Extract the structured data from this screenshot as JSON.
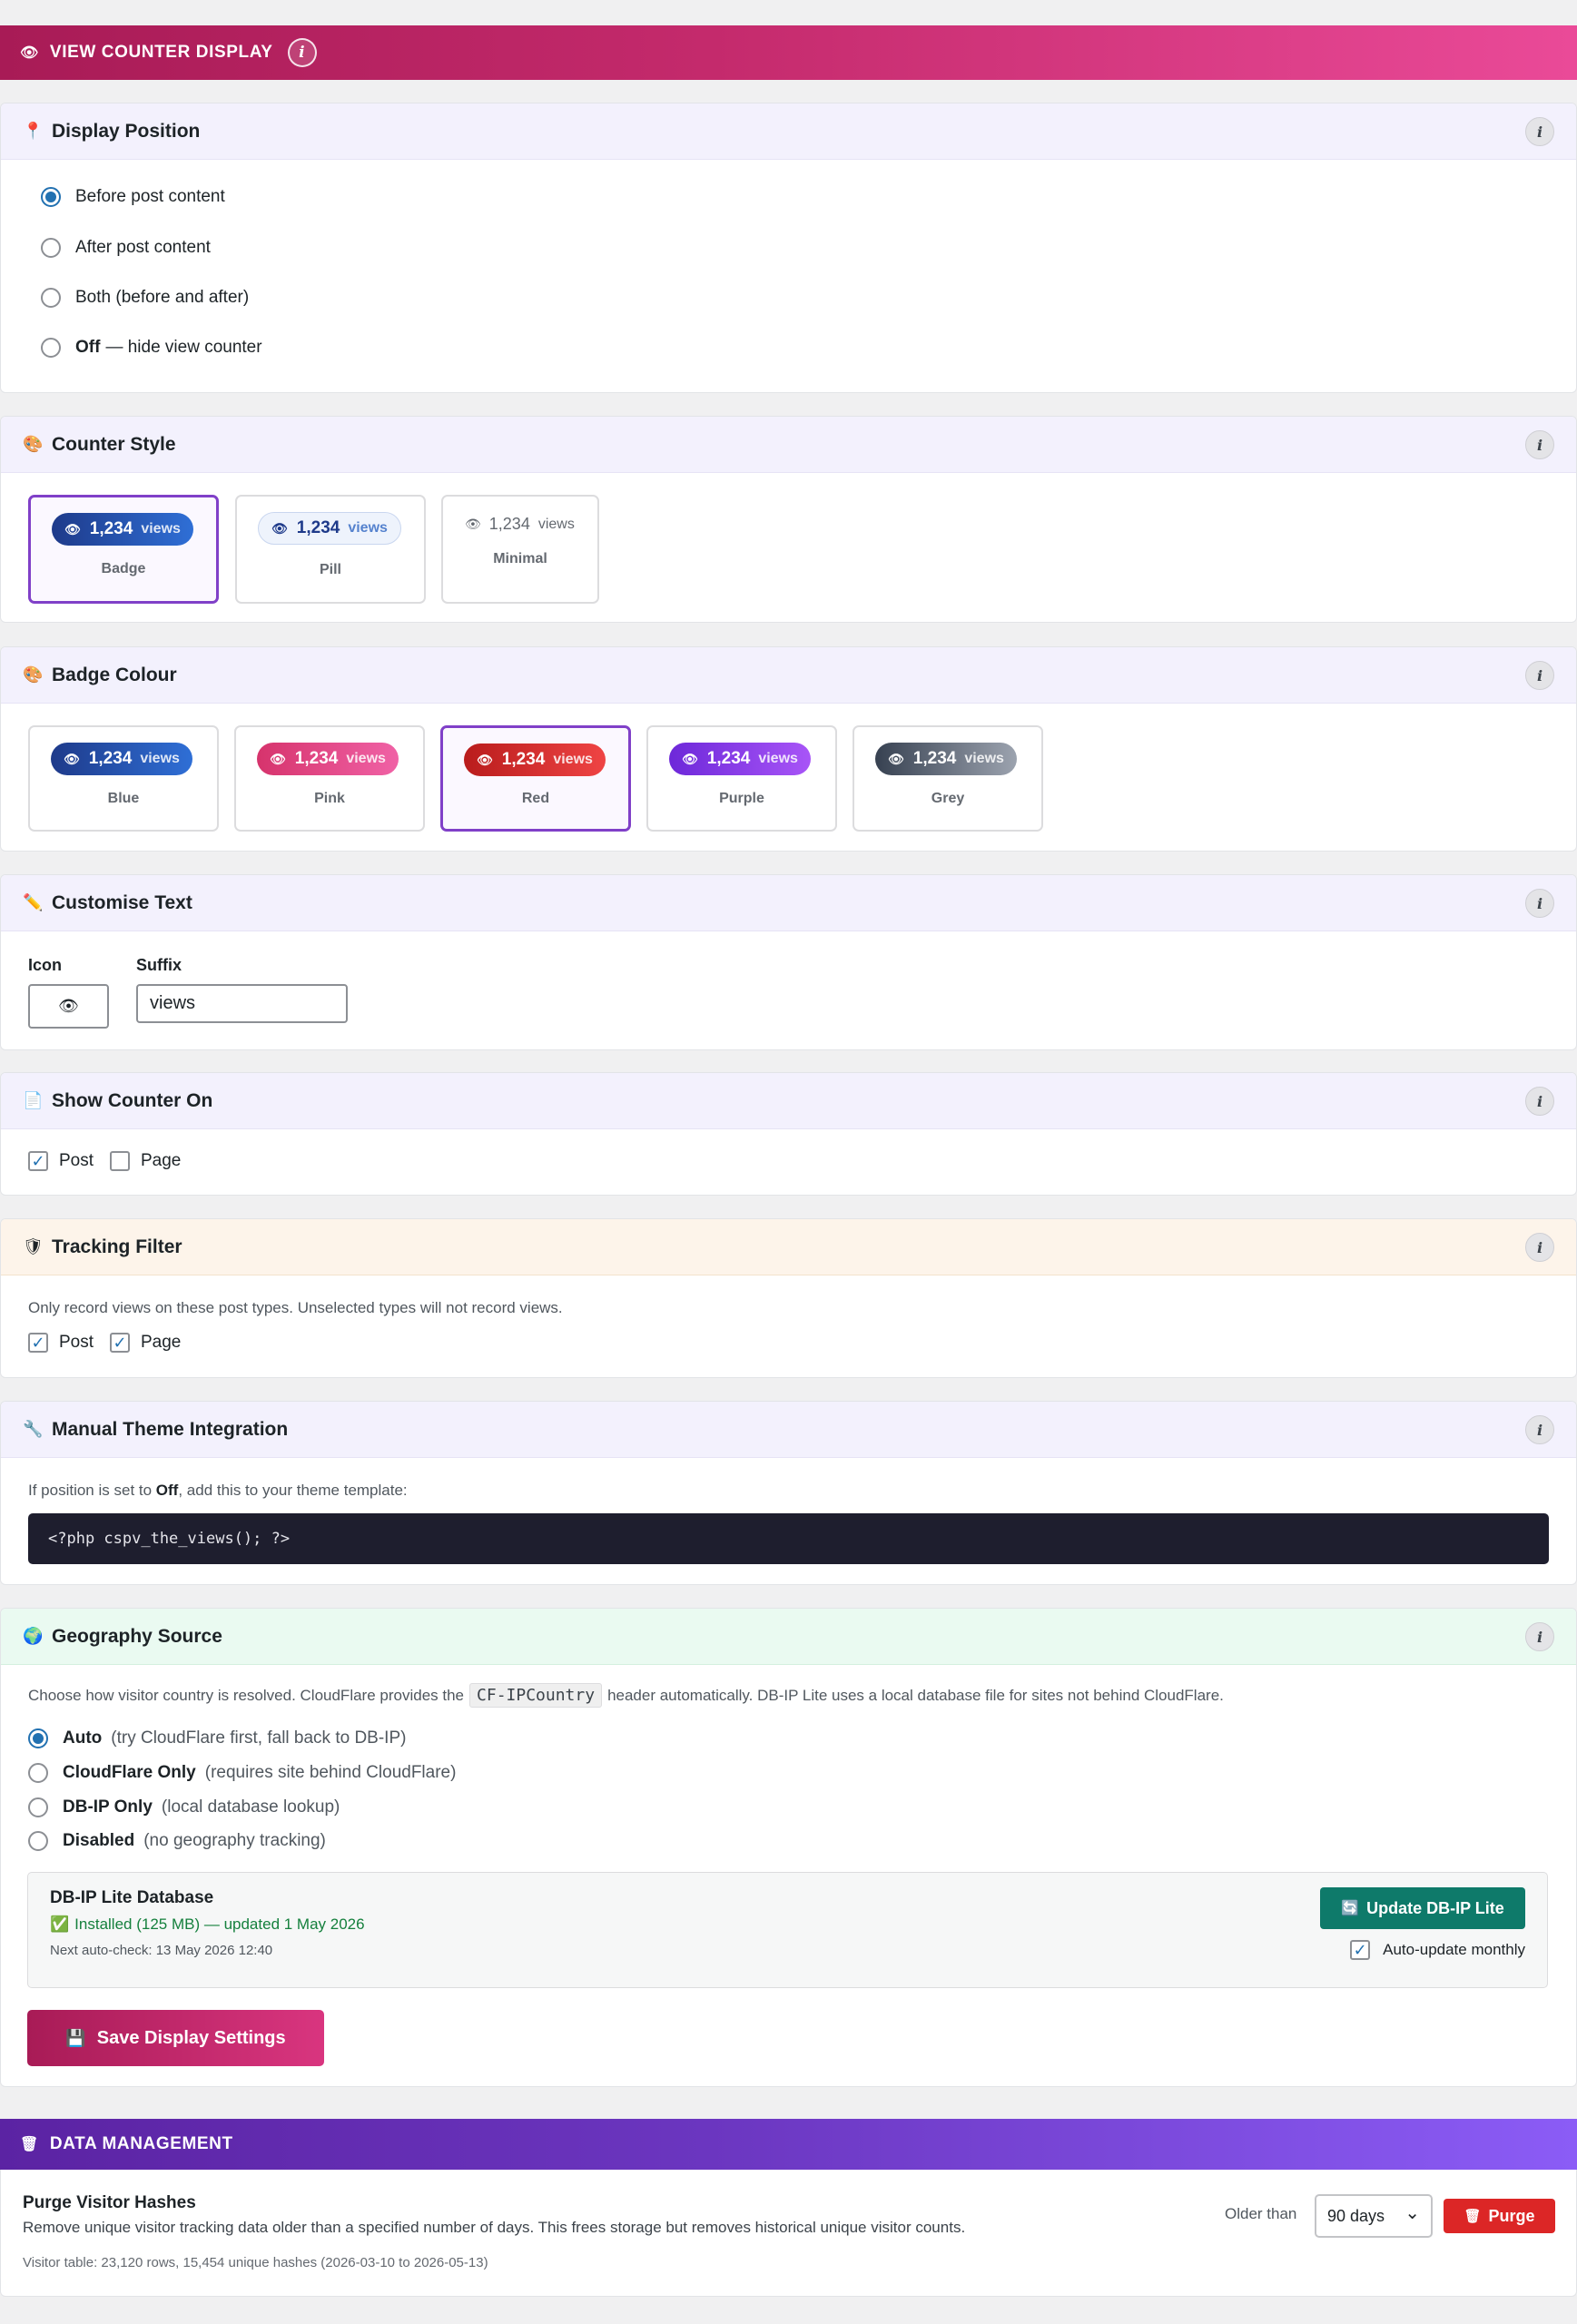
{
  "sections": {
    "view_counter": {
      "title": "VIEW COUNTER DISPLAY",
      "icon": "eye-icon",
      "info": "i"
    },
    "data_management": {
      "title": "DATA MANAGEMENT",
      "icon": "trash-icon"
    }
  },
  "icons": {
    "eye": "👁",
    "pin": "📍",
    "palette": "🎨",
    "pencil": "✏️",
    "page": "📄",
    "shield": "🛡",
    "wrench": "🔧",
    "globe": "🌍",
    "check": "✅",
    "refresh": "🔄",
    "floppy": "💾",
    "trash": "🗑",
    "info": "i",
    "tick": "✓",
    "chevron": "⌄"
  },
  "display_position": {
    "title": "Display Position",
    "options": [
      {
        "label": "Before post content",
        "selected": true
      },
      {
        "label": "After post content",
        "selected": false
      },
      {
        "label": "Both (before and after)",
        "selected": false
      },
      {
        "strong": "Off",
        "label": " — hide view counter",
        "selected": false
      }
    ]
  },
  "counter_style": {
    "title": "Counter Style",
    "count": "1,234",
    "suffix": "views",
    "options": [
      {
        "name": "Badge",
        "selected": true
      },
      {
        "name": "Pill",
        "selected": false
      },
      {
        "name": "Minimal",
        "selected": false
      }
    ]
  },
  "badge_colour": {
    "title": "Badge Colour",
    "count": "1,234",
    "suffix": "views",
    "options": [
      {
        "name": "Blue",
        "selected": false,
        "from": "#1e3a8a",
        "to": "#2f6fd6"
      },
      {
        "name": "Pink",
        "selected": false,
        "from": "#d6336c",
        "to": "#f062a6"
      },
      {
        "name": "Red",
        "selected": true,
        "from": "#b91c1c",
        "to": "#ef4444"
      },
      {
        "name": "Purple",
        "selected": false,
        "from": "#6d28d9",
        "to": "#a855f7"
      },
      {
        "name": "Grey",
        "selected": false,
        "from": "#374151",
        "to": "#9ca3af"
      }
    ]
  },
  "customise_text": {
    "title": "Customise Text",
    "icon_label": "Icon",
    "icon_value": "👁",
    "suffix_label": "Suffix",
    "suffix_value": "views"
  },
  "show_counter_on": {
    "title": "Show Counter On",
    "options": [
      {
        "label": "Post",
        "checked": true
      },
      {
        "label": "Page",
        "checked": false
      }
    ]
  },
  "tracking_filter": {
    "title": "Tracking Filter",
    "description": "Only record views on these post types. Unselected types will not record views.",
    "options": [
      {
        "label": "Post",
        "checked": true
      },
      {
        "label": "Page",
        "checked": true
      }
    ]
  },
  "manual_theme": {
    "title": "Manual Theme Integration",
    "desc_pre": "If position is set to ",
    "desc_strong": "Off",
    "desc_post": ", add this to your theme template:",
    "code": "<?php cspv_the_views(); ?>"
  },
  "geography": {
    "title": "Geography Source",
    "desc_pre": "Choose how visitor country is resolved. CloudFlare provides the",
    "desc_code": "CF-IPCountry",
    "desc_post": "header automatically. DB-IP Lite uses a local database file for sites not behind CloudFlare.",
    "options": [
      {
        "strong": "Auto",
        "note": "(try CloudFlare first, fall back to DB-IP)",
        "selected": true
      },
      {
        "strong": "CloudFlare Only",
        "note": "(requires site behind CloudFlare)",
        "selected": false
      },
      {
        "strong": "DB-IP Only",
        "note": "(local database lookup)",
        "selected": false
      },
      {
        "strong": "Disabled",
        "note": "(no geography tracking)",
        "selected": false
      }
    ],
    "db": {
      "title": "DB-IP Lite Database",
      "status": "Installed (125 MB) — updated 1 May 2026",
      "next_check": "Next auto-check: 13 May 2026 12:40",
      "update_button": "Update DB-IP Lite",
      "auto_update_label": "Auto-update monthly",
      "auto_update": true
    }
  },
  "save_button": "Save Display Settings",
  "purge": {
    "title": "Purge Visitor Hashes",
    "description": "Remove unique visitor tracking data older than a specified number of days. This frees storage but removes historical unique visitor counts.",
    "stats": "Visitor table: 23,120 rows, 15,454 unique hashes (2026-03-10 to 2026-05-13)",
    "older_than_label": "Older than",
    "older_than_value": "90 days",
    "button": "Purge"
  }
}
